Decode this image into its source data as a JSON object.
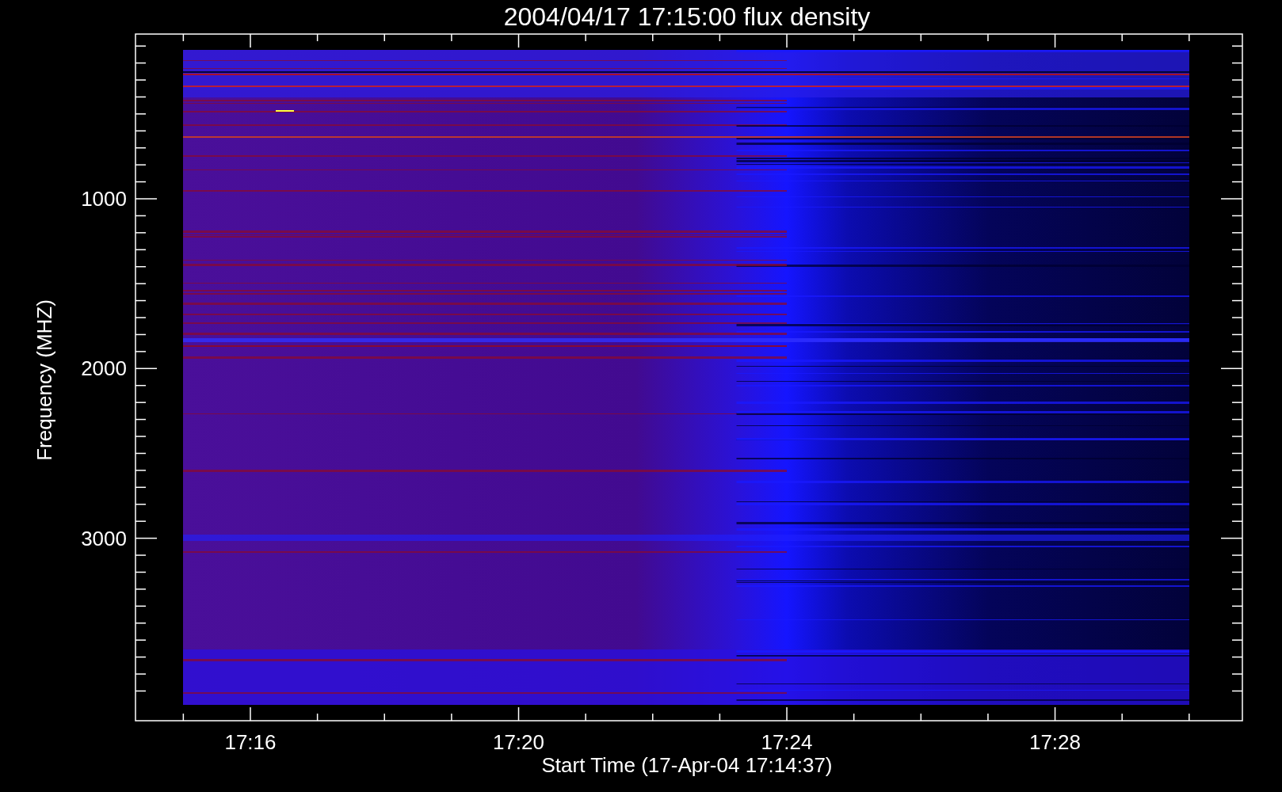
{
  "plot": {
    "title": "2004/04/17 17:15:00 flux density",
    "xlabel": "Start Time (17-Apr-04 17:14:37)",
    "ylabel": "Frequency (MHZ)",
    "x_tick_labels": [
      "17:16",
      "17:20",
      "17:24",
      "17:28"
    ],
    "y_tick_labels": [
      "1000",
      "2000",
      "3000"
    ]
  }
}
